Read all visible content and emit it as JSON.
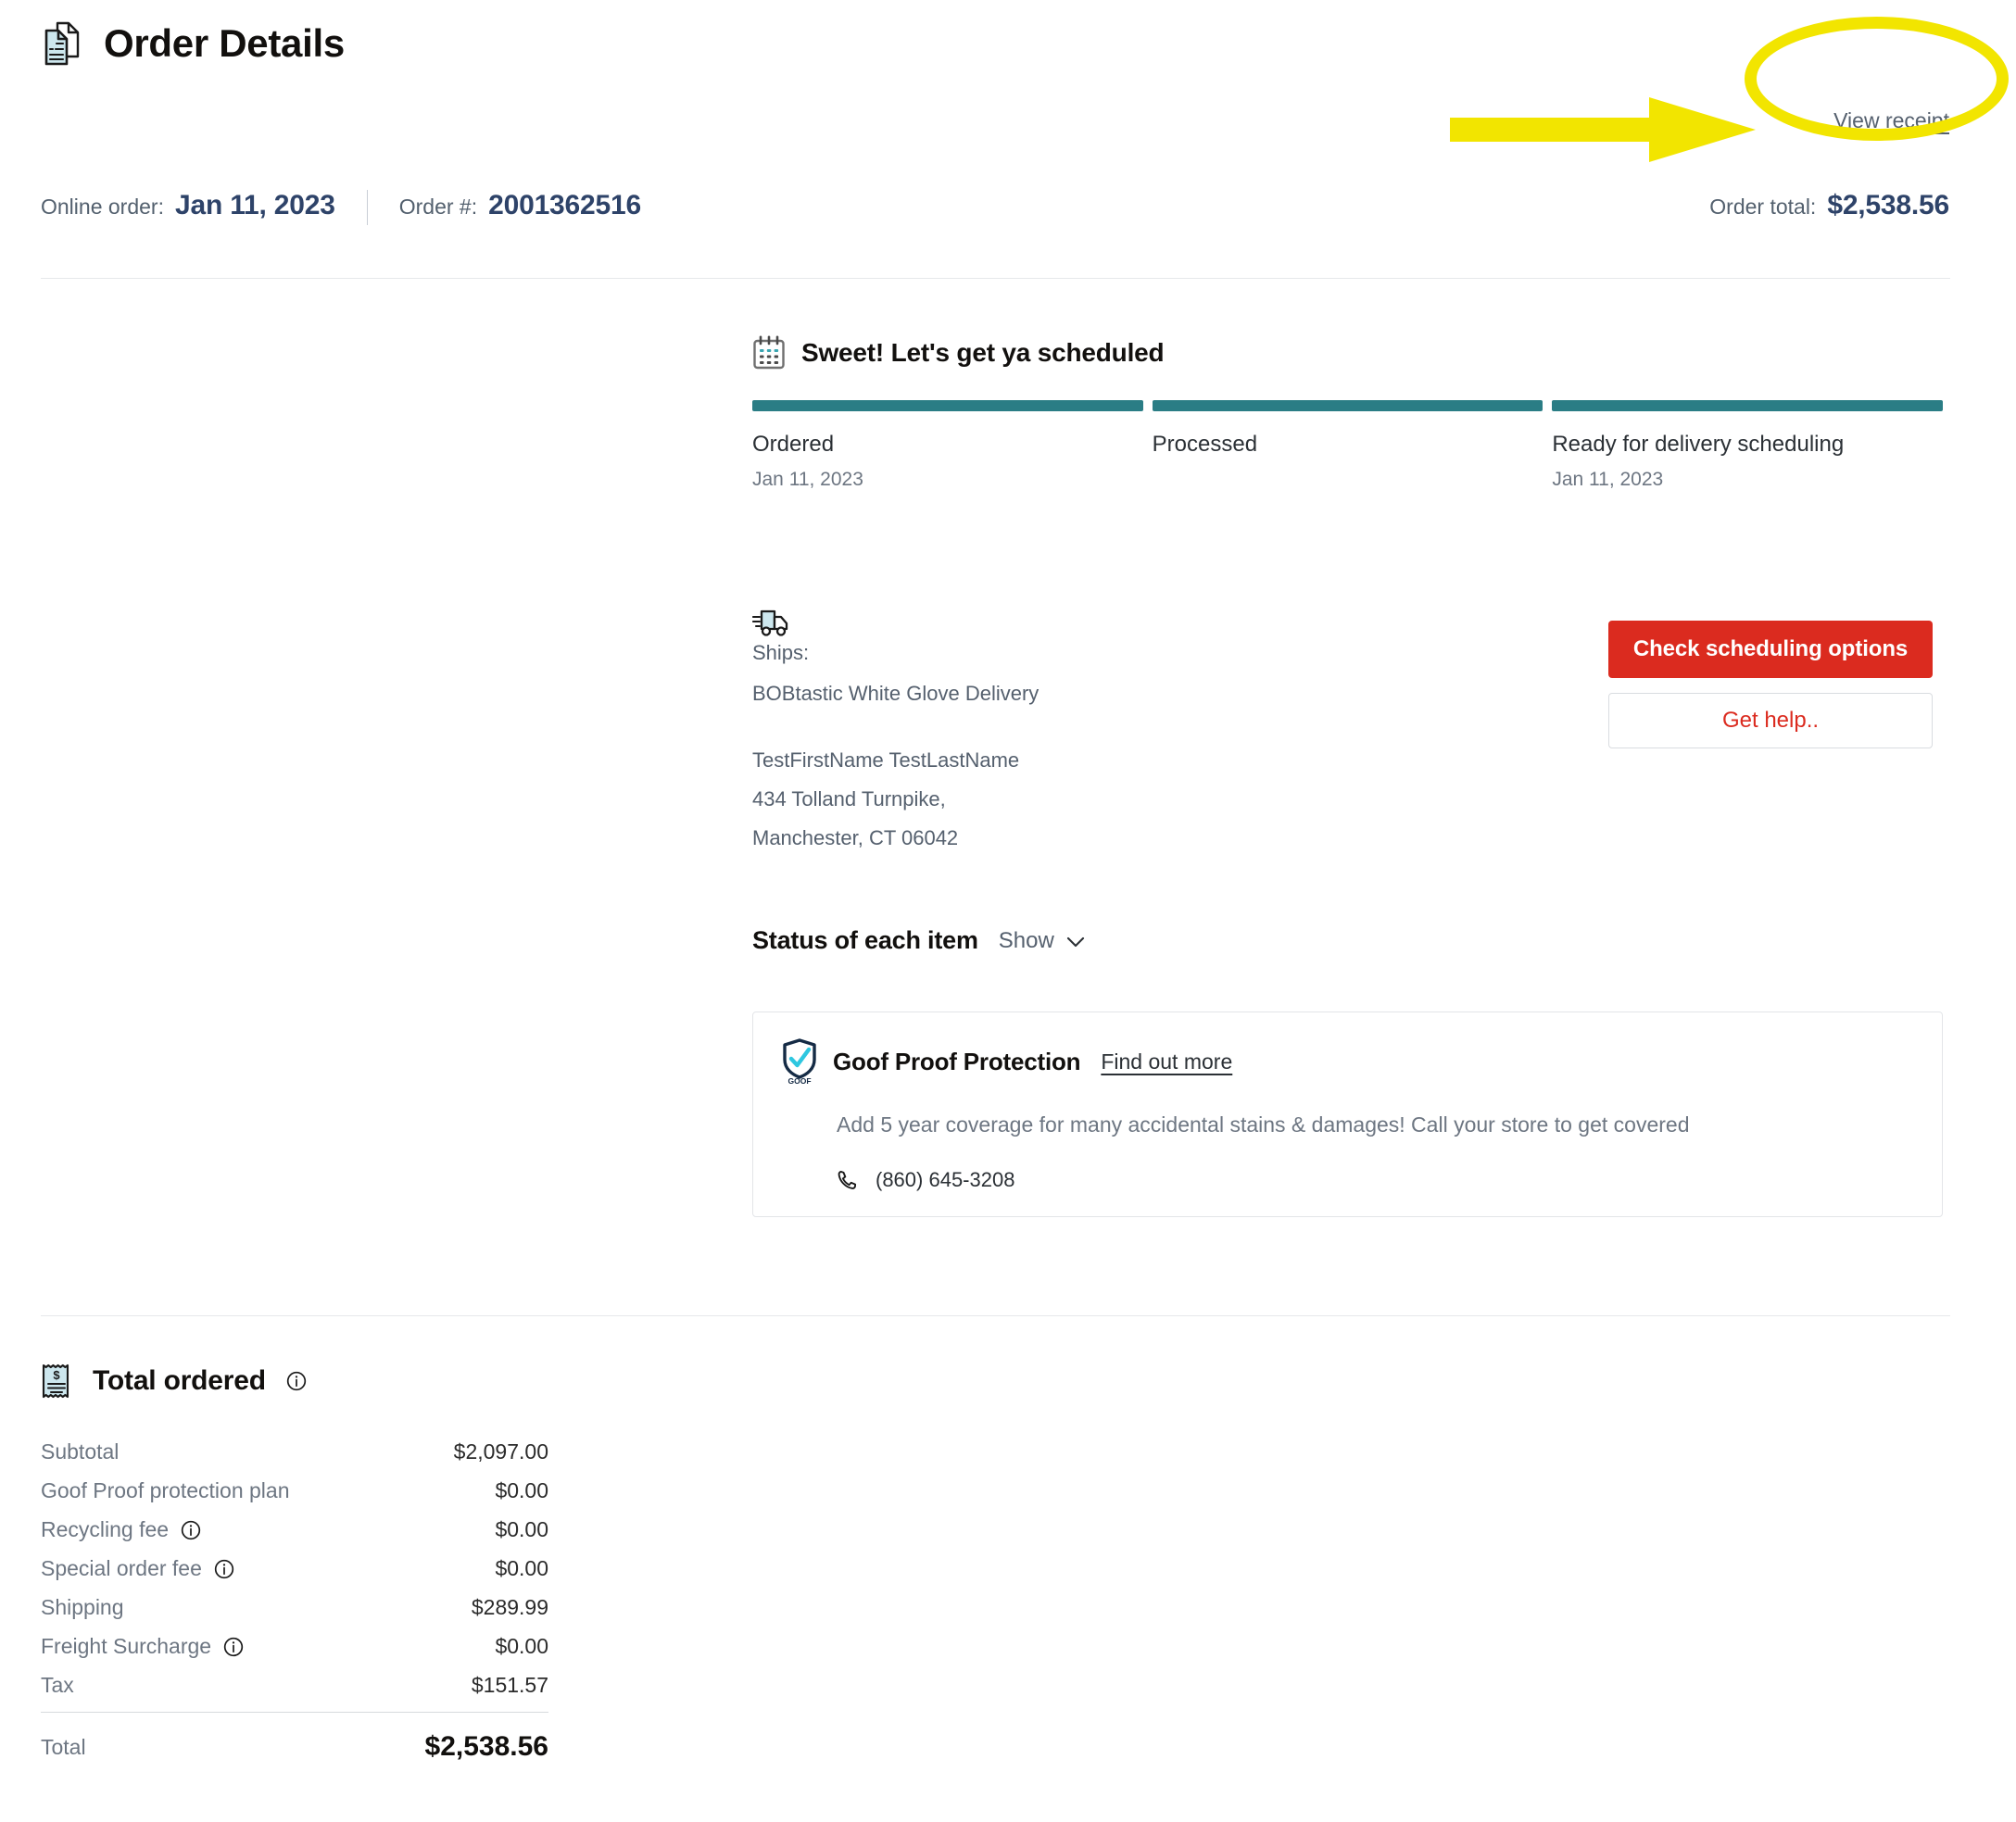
{
  "header": {
    "title": "Order Details",
    "doc_icon": "document-pages-icon",
    "view_receipt_label": "View receipt"
  },
  "annotation": {
    "highlight_color": "#F2E500",
    "shape": "ellipse-with-arrow",
    "target": "View receipt"
  },
  "order_meta": {
    "order_channel_label": "Online order:",
    "order_date": "Jan 11, 2023",
    "order_number_label": "Order #:",
    "order_number": "2001362516",
    "order_total_label": "Order total:",
    "order_total": "$2,538.56"
  },
  "tracker": {
    "icon": "calendar-icon",
    "title": "Sweet! Let's get ya scheduled",
    "bar_color": "#2A7D85",
    "steps": [
      {
        "name": "Ordered",
        "date": "Jan 11, 2023",
        "complete": true
      },
      {
        "name": "Processed",
        "date": "",
        "complete": true
      },
      {
        "name": "Ready for delivery scheduling",
        "date": "Jan 11, 2023",
        "complete": true
      }
    ]
  },
  "shipment": {
    "icon": "delivery-truck-icon",
    "ships_label": "Ships:",
    "method": "BOBtastic White Glove Delivery",
    "recipient": "TestFirstName TestLastName",
    "address_line1": "434 Tolland Turnpike,",
    "address_line2": "Manchester, CT 06042"
  },
  "actions": {
    "primary_label": "Check scheduling options",
    "primary_color": "#DB2B1F",
    "secondary_label": "Get help.."
  },
  "item_status": {
    "title": "Status of each item",
    "toggle_label": "Show",
    "chevron": "chevron-down-icon"
  },
  "goof_proof": {
    "icon": "goof-proof-shield-icon",
    "title": "Goof Proof Protection",
    "link_label": "Find out more",
    "description": "Add 5 year coverage for many accidental stains & damages! Call your store to get covered",
    "phone_icon": "phone-icon",
    "phone": "(860) 645-3208"
  },
  "totals": {
    "icon": "receipt-icon",
    "title": "Total ordered",
    "title_info_icon": "info-icon",
    "rows": [
      {
        "label": "Subtotal",
        "value": "$2,097.00",
        "info": false
      },
      {
        "label": "Goof Proof protection plan",
        "value": "$0.00",
        "info": false
      },
      {
        "label": "Recycling fee",
        "value": "$0.00",
        "info": true
      },
      {
        "label": "Special order fee",
        "value": "$0.00",
        "info": true
      },
      {
        "label": "Shipping",
        "value": "$289.99",
        "info": false
      },
      {
        "label": "Freight Surcharge",
        "value": "$0.00",
        "info": true
      },
      {
        "label": "Tax",
        "value": "$151.57",
        "info": false
      }
    ],
    "total_label": "Total",
    "total_value": "$2,538.56"
  }
}
